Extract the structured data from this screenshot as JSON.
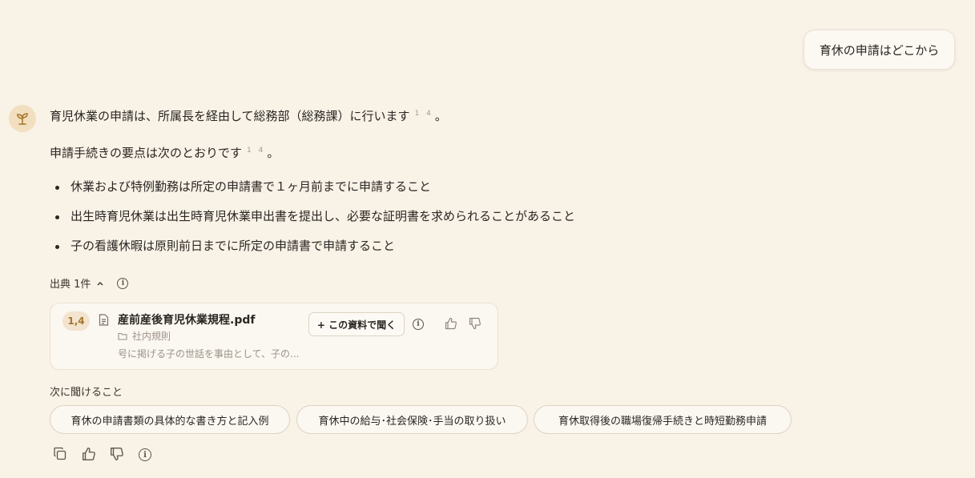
{
  "user_message": "育休の申請はどこから",
  "assistant": {
    "para1": "育児休業の申請は、所属長を経由して総務部（総務課）に行います",
    "para1_refs": "1 4",
    "para1_end": "。",
    "para2": "申請手続きの要点は次のとおりです",
    "para2_refs": "1 4",
    "para2_end": "。",
    "bullets": [
      "休業および特例勤務は所定の申請書で１ヶ月前までに申請すること",
      "出生時育児休業は出生時育児休業申出書を提出し、必要な証明書を求められることがあること",
      "子の看護休暇は原則前日までに所定の申請書で申請すること"
    ]
  },
  "sources": {
    "toggle_label": "出典 1件",
    "cards": [
      {
        "badge": "1,4",
        "title": "産前産後育児休業規程.pdf",
        "folder": "社内規則",
        "snippet": "号に掲げる子の世話を事由として、子の...",
        "ask_button": "+ この資料で聞く"
      }
    ]
  },
  "next": {
    "label": "次に聞けること",
    "chips": [
      "育休の申請書類の具体的な書き方と記入例",
      "育休中の給与･社会保険･手当の取り扱い",
      "育休取得後の職場復帰手続きと時短勤務申請"
    ]
  },
  "icons": {
    "avatar": "sprout-icon",
    "doc": "document-icon",
    "folder": "folder-icon",
    "info": "info-icon",
    "thumbs_up": "thumbs-up-icon",
    "thumbs_down": "thumbs-down-icon",
    "copy": "copy-icon",
    "chevron": "chevron-up-icon"
  },
  "colors": {
    "background": "#f9f2e7",
    "accent": "#a8752e",
    "avatar_bg": "#f1dfbf"
  }
}
